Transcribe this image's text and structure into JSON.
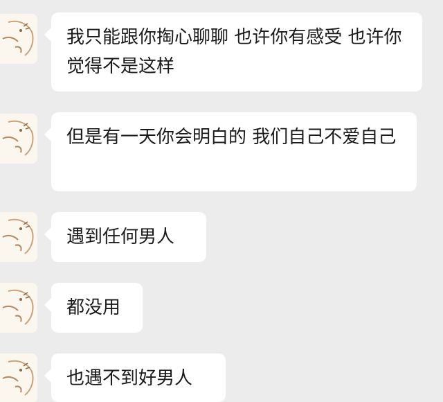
{
  "chat": {
    "messages": [
      {
        "text": "我只能跟你掏心聊聊 也许你有感受 也许你觉得不是这样"
      },
      {
        "text": "但是有一天你会明白的 我们自己不爱自己"
      },
      {
        "text": "遇到任何男人"
      },
      {
        "text": "都没用"
      },
      {
        "text": "也遇不到好男人"
      }
    ],
    "colors": {
      "background": "#ececec",
      "bubble": "#ffffff",
      "text": "#1a1a1a"
    },
    "avatar_icon": "cartoon-face-sketch-icon"
  }
}
